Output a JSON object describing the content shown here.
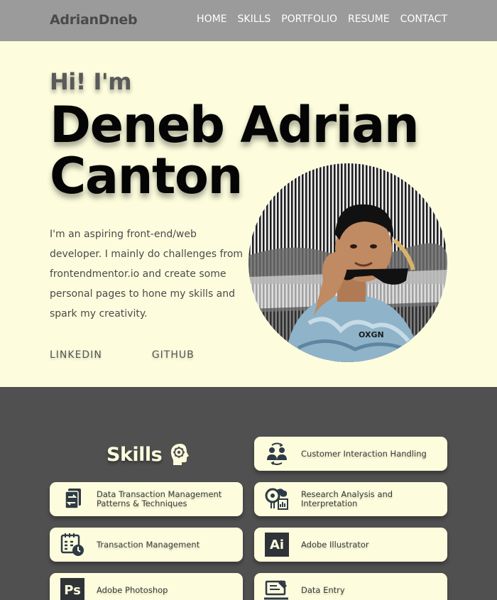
{
  "nav": {
    "logo": "AdrianDneb",
    "items": [
      "HOME",
      "SKILLS",
      "PORTFOLIO",
      "RESUME",
      "CONTACT"
    ]
  },
  "hero": {
    "greeting": "Hi! I'm",
    "name": "Deneb Adrian Canton",
    "bio": "I'm an aspiring front-end/web developer. I mainly do challenges from frontendmentor.io and create some personal pages to hone my skills and spark my creativity.",
    "links": [
      "LINKEDIN",
      "GITHUB"
    ],
    "shirt_text": "OXGN"
  },
  "skills": {
    "title": "Skills",
    "items": [
      {
        "label": "Customer Interaction Handling",
        "icon": "people-exchange-icon"
      },
      {
        "label": "Data Transaction Management Patterns & Techniques",
        "icon": "document-transfer-icon"
      },
      {
        "label": "Research Analysis and Interpretation",
        "icon": "research-analysis-icon"
      },
      {
        "label": "Transaction Management",
        "icon": "calendar-clock-icon"
      },
      {
        "label": "Adobe Illustrator",
        "icon": "adobe-illustrator-icon",
        "badge": "Ai"
      },
      {
        "label": "Adobe Photoshop",
        "icon": "adobe-photoshop-icon",
        "badge": "Ps"
      },
      {
        "label": "Data Entry",
        "icon": "data-entry-icon"
      }
    ]
  },
  "colors": {
    "nav_bg": "#9b9b9b",
    "hero_bg": "#fdfdde",
    "skills_bg": "#505050",
    "card_bg": "#fdfdde"
  }
}
